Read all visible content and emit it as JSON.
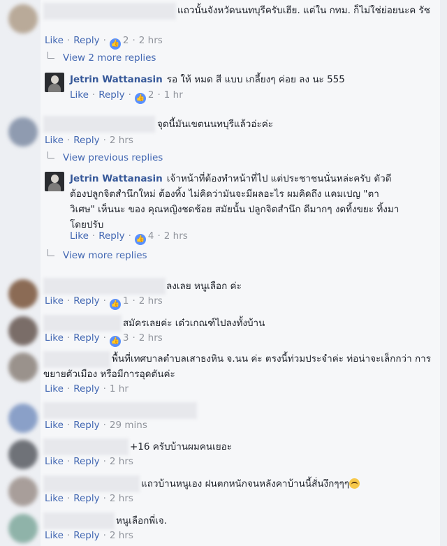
{
  "common": {
    "like": "Like",
    "reply": "Reply",
    "sep": "·"
  },
  "comments": [
    {
      "text": "แถวนั้นจังหวัดนนทบุรีครับเฮีย. แต่ใน กทม. ก็ไม่ใช่ย่อยนะค รัช",
      "reactions": "2",
      "time": "2 hrs"
    },
    {
      "reply_author": "Jetrin Wattanasin",
      "text": "รอ ให้ หมด สี แบบ เกลี้ยงๆ ค่อย ลง นะ 555",
      "reactions": "2",
      "time": "1 hr"
    },
    {
      "text": "จุดนี้มันเขตนนทบุรีแล้วอ่ะค่ะ",
      "time": "2 hrs"
    },
    {
      "reply_author": "Jetrin Wattanasin",
      "text": "เจ้าหน้าที่ต้องทำหน้าที่ไป แต่ประชาชนนั่นหล่ะครับ ตัวดี ต้องปลูกจิตสำนึกใหม่ ต้องทิ้ง ไม่คิดว่ามันจะมีผลอะไร ผมคิดถึง แคมเปญ \"ตา วิเศษ\" เห็นนะ ของ คุณหญิงชดช้อย สมัยนั้น ปลูกจิตสำนึก ดีมากๆ งดทิ้งขยะ ทิ้งมา โดยปรับ",
      "reactions": "4",
      "time": "2 hrs"
    },
    {
      "text": "ลงเลย หนูเลือก ค่ะ",
      "reactions": "1",
      "time": "2 hrs"
    },
    {
      "text": "สมัครเลยค่ะ เด๋วเกณฑ์ไปลงทั้งบ้าน",
      "reactions": "3",
      "time": "2 hrs"
    },
    {
      "text": "พื้นที่เทศบาลตำบลเสาธงหิน จ.นน ค่ะ ตรงนี้ท่วมประจำค่ะ ท่อน่าจะเล็กกว่า การขยายตัวเมือง หรือมีการอุดตันค่ะ",
      "time": "1 hr"
    },
    {
      "text": "",
      "time": "29 mins"
    },
    {
      "text": "+16 ครับบ้านผมคนเยอะ",
      "time": "2 hrs"
    },
    {
      "text": "แถวบ้านหนูเอง ฝนตกหนักจนหลังคาบ้านนี้สั่นงึกๆๆๆ",
      "time": "2 hrs"
    },
    {
      "text": "หนูเลือกพี่เจ.",
      "time": "2 hrs"
    }
  ],
  "more_links": {
    "view_2_more": "View 2 more replies",
    "view_previous": "View previous replies",
    "view_more": "View more replies"
  },
  "icons": {
    "like_badge": "thumbs-up-icon",
    "reply_arrow": "reply-arrow-icon",
    "emoji": "crying-laughing-emoji-icon"
  },
  "colors": {
    "link": "#4267b2",
    "name": "#365899",
    "meta": "#90949c",
    "like_badge": "#5890ff"
  }
}
